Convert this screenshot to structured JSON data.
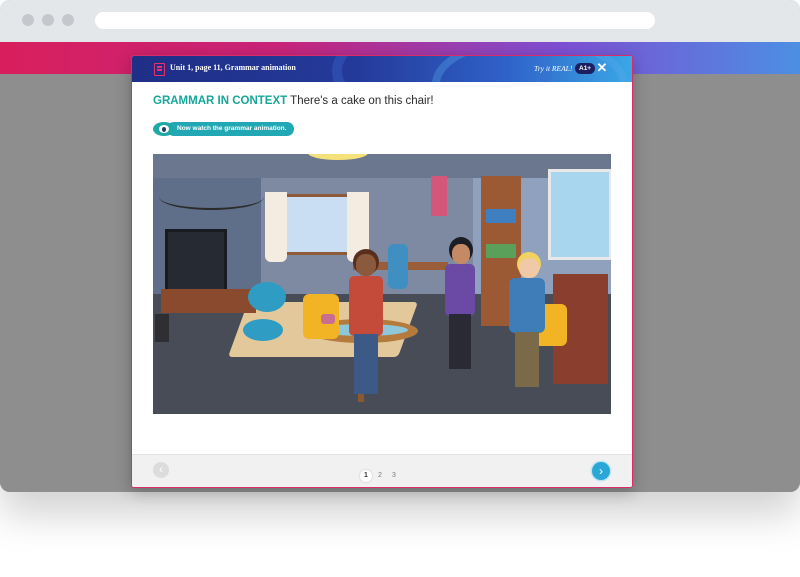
{
  "modal": {
    "title": "Unit 1, page 11, Grammar animation",
    "brand": "Try it REAL!",
    "level": "A1+",
    "close_symbol": "✕",
    "heading_label": "GRAMMAR IN CONTEXT",
    "heading_sentence": "There's a cake on this chair!",
    "watch_label": "Now watch the grammar animation."
  },
  "pagination": {
    "pages": [
      "1",
      "2",
      "3"
    ],
    "current": "1",
    "prev_symbol": "‹",
    "next_symbol": "›"
  },
  "colors": {
    "accent_teal": "#17a69a",
    "header_blue": "#243a9a",
    "pink": "#d81f5c",
    "next_button": "#2aa7d6"
  },
  "icons": [
    "book-icon",
    "close-icon",
    "eye-icon",
    "chevron-left-icon",
    "chevron-right-icon"
  ]
}
